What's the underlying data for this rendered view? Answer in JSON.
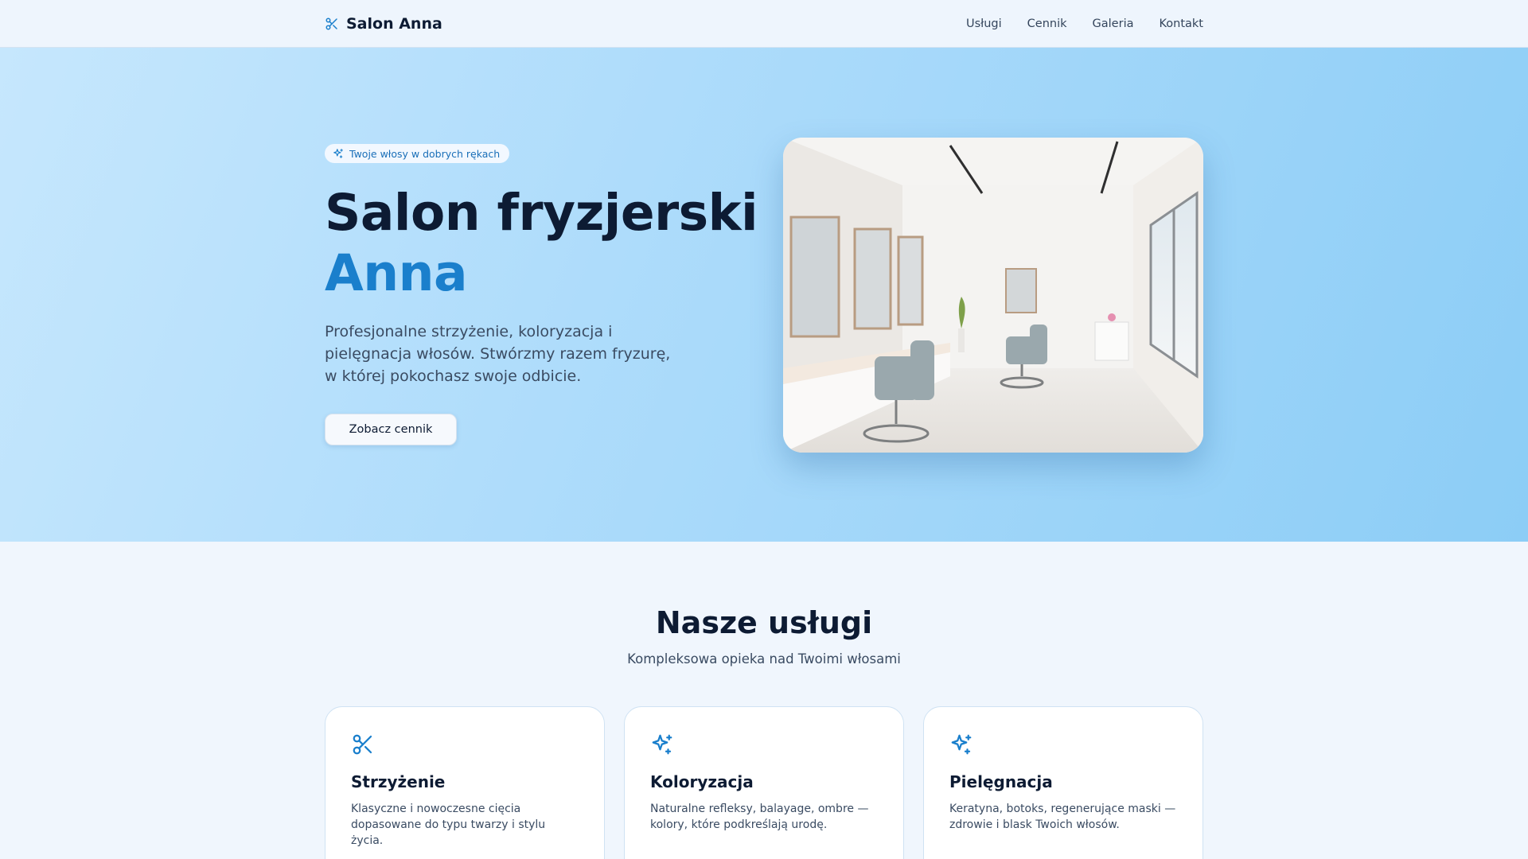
{
  "nav": {
    "brand": "Salon Anna",
    "brand_icon": "scissors-icon",
    "links": [
      "Usługi",
      "Cennik",
      "Galeria",
      "Kontakt"
    ]
  },
  "hero": {
    "badge": "Twoje włosy w dobrych rękach",
    "badge_icon": "sparkles-icon",
    "title_line1": "Salon fryzjerski",
    "title_line2": "Anna",
    "description": "Profesjonalne strzyżenie, koloryzacja i pielęgnacja włosów. Stwórzmy razem fryzurę, w której pokochasz swoje odbicie.",
    "cta_label": "Zobacz cennik"
  },
  "services": {
    "title": "Nasze usługi",
    "subtitle": "Kompleksowa opieka nad Twoimi włosami",
    "cards": [
      {
        "icon": "scissors-icon",
        "title": "Strzyżenie",
        "desc": "Klasyczne i nowoczesne cięcia dopasowane do typu twarzy i stylu życia."
      },
      {
        "icon": "sparkles-icon",
        "title": "Koloryzacja",
        "desc": "Naturalne refleksy, balayage, ombre — kolory, które podkreślają urodę."
      },
      {
        "icon": "sparkles-icon",
        "title": "Pielęgnacja",
        "desc": "Keratyna, botoks, regenerujące maski — zdrowie i blask Twoich włosów."
      }
    ]
  },
  "colors": {
    "accent": "#1a7fcc",
    "heading": "#0d1b33"
  }
}
